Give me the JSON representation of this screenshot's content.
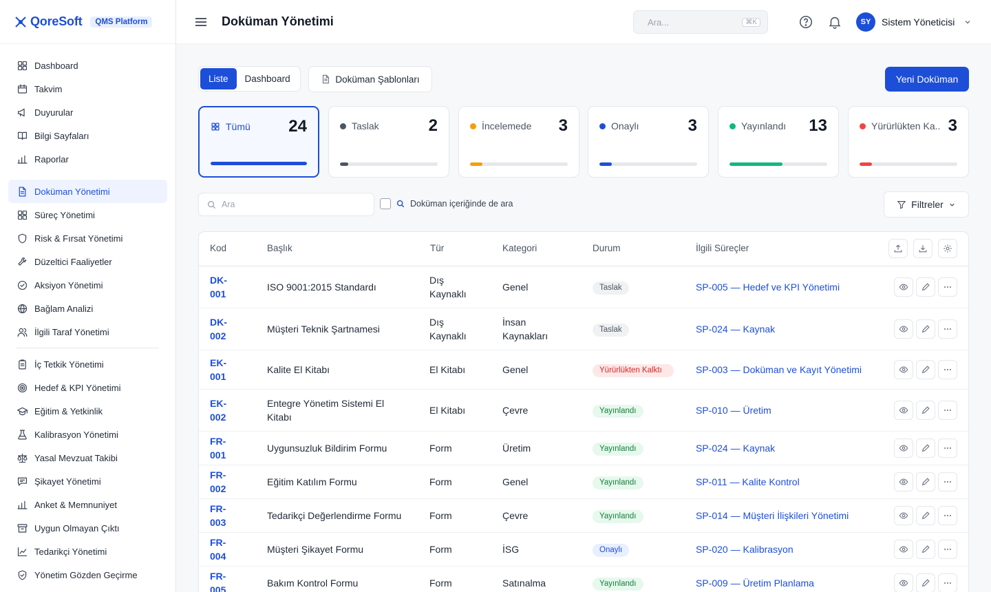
{
  "brand": {
    "name": "QoreSoft",
    "badge": "QMS Platform"
  },
  "sidebar": {
    "group1": [
      {
        "label": "Dashboard",
        "icon": "grid-icon"
      },
      {
        "label": "Takvim",
        "icon": "calendar-icon"
      },
      {
        "label": "Duyurular",
        "icon": "megaphone-icon"
      },
      {
        "label": "Bilgi Sayfaları",
        "icon": "book-icon"
      },
      {
        "label": "Raporlar",
        "icon": "bar-chart-icon"
      }
    ],
    "group2": [
      {
        "label": "Doküman Yönetimi",
        "icon": "document-icon",
        "active": true
      },
      {
        "label": "Süreç Yönetimi",
        "icon": "grid-icon"
      },
      {
        "label": "Risk & Fırsat Yönetimi",
        "icon": "shield-icon"
      },
      {
        "label": "Düzeltici Faaliyetler",
        "icon": "wrench-icon"
      },
      {
        "label": "Aksiyon Yönetimi",
        "icon": "check-circle-icon"
      },
      {
        "label": "Bağlam Analizi",
        "icon": "globe-icon"
      },
      {
        "label": "İlgili Taraf Yönetimi",
        "icon": "users-icon"
      }
    ],
    "group3": [
      {
        "label": "İç Tetkik Yönetimi",
        "icon": "clipboard-icon"
      },
      {
        "label": "Hedef & KPI Yönetimi",
        "icon": "target-icon"
      },
      {
        "label": "Eğitim & Yetkinlik",
        "icon": "graduation-cap-icon"
      },
      {
        "label": "Kalibrasyon Yönetimi",
        "icon": "flask-icon"
      },
      {
        "label": "Yasal Mevzuat Takibi",
        "icon": "scale-icon"
      },
      {
        "label": "Şikayet Yönetimi",
        "icon": "message-icon"
      },
      {
        "label": "Anket & Memnuniyet",
        "icon": "bar-chart-icon"
      },
      {
        "label": "Uygun Olmayan Çıktı",
        "icon": "archive-icon"
      },
      {
        "label": "Tedarikçi Yönetimi",
        "icon": "line-chart-icon"
      },
      {
        "label": "Yönetim Gözden Geçirme",
        "icon": "shield-check-icon"
      }
    ]
  },
  "topbar": {
    "title": "Doküman Yönetimi",
    "search_placeholder": "Ara...",
    "shortcut": "⌘K",
    "user_initials": "SY",
    "user_name": "Sistem Yöneticisi"
  },
  "toolbar": {
    "tabs": [
      {
        "label": "Liste",
        "active": true
      },
      {
        "label": "Dashboard",
        "active": false
      }
    ],
    "templates_label": "Doküman Şablonları",
    "new_label": "Yeni Doküman"
  },
  "stats": [
    {
      "label": "Tümü",
      "count": "24",
      "color": "#1d4ed8",
      "progress": 1.0,
      "active": true
    },
    {
      "label": "Taslak",
      "count": "2",
      "color": "#4b5563",
      "progress": 0.083
    },
    {
      "label": "İncelemede",
      "count": "3",
      "color": "#f59e0b",
      "progress": 0.125
    },
    {
      "label": "Onaylı",
      "count": "3",
      "color": "#1d4ed8",
      "progress": 0.125
    },
    {
      "label": "Yayınlandı",
      "count": "13",
      "color": "#10b981",
      "progress": 0.54
    },
    {
      "label": "Yürürlükten Ka...",
      "count": "3",
      "color": "#ef4444",
      "progress": 0.125
    }
  ],
  "filters": {
    "search_placeholder": "Ara",
    "content_search_label": "Doküman içeriğinde de ara",
    "filters_label": "Filtreler"
  },
  "table": {
    "columns": [
      "Kod",
      "Başlık",
      "Tür",
      "Kategori",
      "Durum",
      "İlgili Süreçler"
    ],
    "rows": [
      {
        "code": "DK-001",
        "title": "ISO 9001:2015 Standardı",
        "type": "Dış Kaynaklı",
        "category": "Genel",
        "status": "Taslak",
        "status_kind": "taslak",
        "process": "SP-005 — Hedef ve KPI Yönetimi"
      },
      {
        "code": "DK-002",
        "title": "Müşteri Teknik Şartnamesi",
        "type": "Dış Kaynaklı",
        "category": "İnsan Kaynakları",
        "status": "Taslak",
        "status_kind": "taslak",
        "process": "SP-024 — Kaynak"
      },
      {
        "code": "EK-001",
        "title": "Kalite El Kitabı",
        "type": "El Kitabı",
        "category": "Genel",
        "status": "Yürürlükten Kalktı",
        "status_kind": "kalk",
        "process": "SP-003 — Doküman ve Kayıt Yönetimi"
      },
      {
        "code": "EK-002",
        "title": "Entegre Yönetim Sistemi El Kitabı",
        "type": "El Kitabı",
        "category": "Çevre",
        "status": "Yayınlandı",
        "status_kind": "yay",
        "process": "SP-010 — Üretim"
      },
      {
        "code": "FR-001",
        "title": "Uygunsuzluk Bildirim Formu",
        "type": "Form",
        "category": "Üretim",
        "status": "Yayınlandı",
        "status_kind": "yay",
        "process": "SP-024 — Kaynak"
      },
      {
        "code": "FR-002",
        "title": "Eğitim Katılım Formu",
        "type": "Form",
        "category": "Genel",
        "status": "Yayınlandı",
        "status_kind": "yay",
        "process": "SP-011 — Kalite Kontrol"
      },
      {
        "code": "FR-003",
        "title": "Tedarikçi Değerlendirme Formu",
        "type": "Form",
        "category": "Çevre",
        "status": "Yayınlandı",
        "status_kind": "yay",
        "process": "SP-014 — Müşteri İlişkileri Yönetimi"
      },
      {
        "code": "FR-004",
        "title": "Müşteri Şikayet Formu",
        "type": "Form",
        "category": "İSG",
        "status": "Onaylı",
        "status_kind": "onay",
        "process": "SP-020 — Kalibrasyon"
      },
      {
        "code": "FR-005",
        "title": "Bakım Kontrol Formu",
        "type": "Form",
        "category": "Satınalma",
        "status": "Yayınlandı",
        "status_kind": "yay",
        "process": "SP-009 — Üretim Planlama"
      }
    ]
  }
}
